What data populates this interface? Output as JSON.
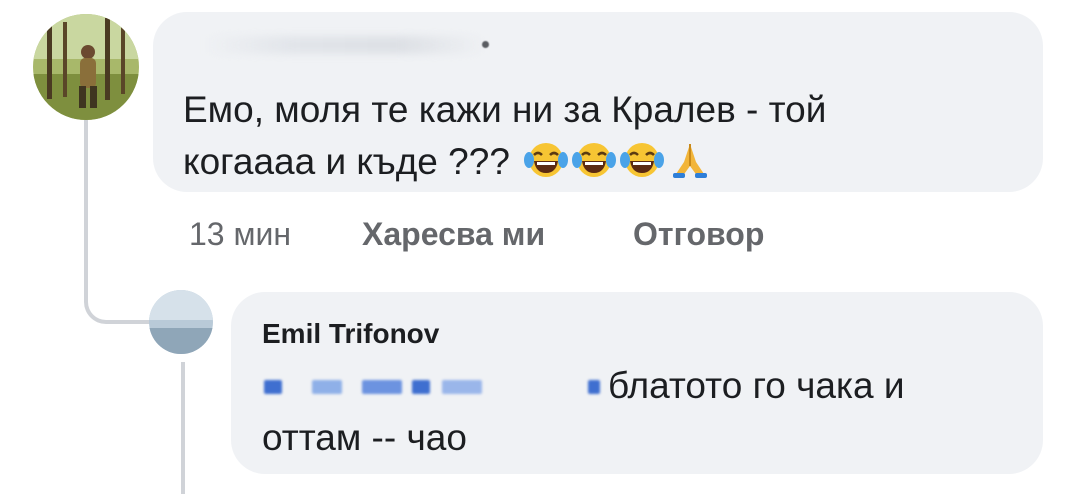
{
  "comment": {
    "text_line1": "Емо, моля те кажи ни за Кралев - той",
    "text_line2": "когаааа и къде ???",
    "emojis": [
      "tears-of-joy-emoji",
      "tears-of-joy-emoji",
      "tears-of-joy-emoji",
      "folded-hands-emoji"
    ],
    "time": "13 мин",
    "like_label": "Харесва ми",
    "reply_label": "Отговор"
  },
  "reply": {
    "author": "Emil Trifonov",
    "text_line1": "блатото го чака и",
    "text_line2": "оттам -- чао"
  },
  "colors": {
    "bubble": "#f0f2f5",
    "text": "#1c1e21",
    "meta": "#65676b",
    "thread_line": "#d0d3d8"
  }
}
